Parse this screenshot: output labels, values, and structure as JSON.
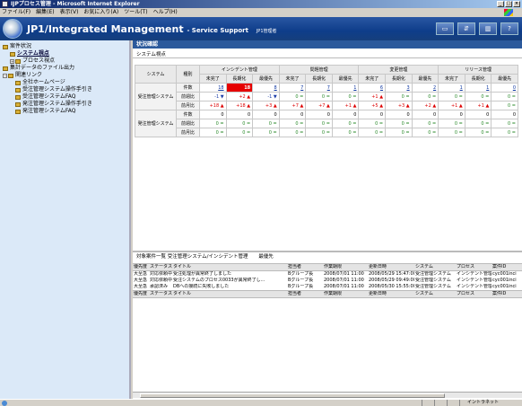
{
  "window": {
    "title": "IJPプロセス管理 - Microsoft Internet Explorer"
  },
  "menu": [
    "ファイル(F)",
    "編集(E)",
    "表示(V)",
    "お気に入り(A)",
    "ツール(T)",
    "ヘルプ(H)"
  ],
  "header": {
    "title": "JP1/Integrated Management",
    "subtitle": "- Service Support",
    "manager": "JP1管理者"
  },
  "sidebar": {
    "items": [
      {
        "label": "案件状況",
        "level": 1
      },
      {
        "label": "システム視点",
        "level": 2,
        "selected": true
      },
      {
        "label": "プロセス視点",
        "level": 2
      },
      {
        "label": "集計データのファイル出力",
        "level": 1
      },
      {
        "label": "関連リンク",
        "level": 1
      },
      {
        "label": "全社ホームページ",
        "level": 3
      },
      {
        "label": "受注管理システム操作手引き",
        "level": 3
      },
      {
        "label": "受注管理システムFAQ",
        "level": 3
      },
      {
        "label": "発注管理システム操作手引き",
        "level": 3
      },
      {
        "label": "発注管理システムFAQ",
        "level": 3
      }
    ]
  },
  "main": {
    "header": "状況確認",
    "section": "システム視点",
    "table": {
      "col_system": "システム",
      "col_kind": "種別",
      "groups": [
        "インシデント管理",
        "問題管理",
        "変更管理",
        "リリース管理"
      ],
      "subcols": [
        "未完了",
        "長期化",
        "最優先"
      ],
      "systems": [
        {
          "name": "受注管理システム",
          "rows": [
            {
              "label": "件数",
              "cells": [
                "18",
                "18",
                "8",
                "7",
                "7",
                "1",
                "6",
                "3",
                "2",
                "1",
                "1",
                "0"
              ]
            },
            {
              "label": "前週比",
              "cells": [
                "-1 ▼",
                "+2 ▲",
                "-1 ▼",
                "0 =",
                "0 =",
                "0 =",
                "+1 ▲",
                "0 =",
                "0 =",
                "0 =",
                "0 =",
                "0 ="
              ]
            },
            {
              "label": "前月比",
              "cells": [
                "+18 ▲",
                "+18 ▲",
                "+3 ▲",
                "+7 ▲",
                "+7 ▲",
                "+1 ▲",
                "+5 ▲",
                "+3 ▲",
                "+2 ▲",
                "+1 ▲",
                "+1 ▲",
                "0 ="
              ]
            }
          ]
        },
        {
          "name": "発注管理システム",
          "rows": [
            {
              "label": "件数",
              "cells": [
                "0",
                "0",
                "0",
                "0",
                "0",
                "0",
                "0",
                "0",
                "0",
                "0",
                "0",
                "0"
              ]
            },
            {
              "label": "前週比",
              "cells": [
                "0 =",
                "0 =",
                "0 =",
                "0 =",
                "0 =",
                "0 =",
                "0 =",
                "0 =",
                "0 =",
                "0 =",
                "0 =",
                "0 ="
              ]
            },
            {
              "label": "前月比",
              "cells": [
                "0 =",
                "0 =",
                "0 =",
                "0 =",
                "0 =",
                "0 =",
                "0 =",
                "0 =",
                "0 =",
                "0 =",
                "0 =",
                "0 ="
              ]
            }
          ]
        }
      ]
    },
    "list": {
      "title": "対象案件一覧 受注管理システム/インシデント管理",
      "tab": "最優先",
      "columns": [
        "優先度",
        "ステータス",
        "タイトル",
        "担当者",
        "作業期限",
        "更新日時",
        "システム",
        "プロセス",
        "案件ID"
      ],
      "rows": [
        [
          "大至急",
          "対応依頼中",
          "受注処理が異常終了しました",
          "Bグループ長",
          "2008/07/01 11:00",
          "2008/05/29 15:47:00",
          "受注管理システム",
          "インシデント管理",
          "cyc001inci"
        ],
        [
          "大至急",
          "対応依頼中",
          "受注システムのプロセス0033が異常終了し...",
          "Bグループ長",
          "2008/07/01 11:00",
          "2008/05/29 09:49:00",
          "受注管理システム",
          "インシデント管理",
          "cyc001inci"
        ],
        [
          "大至急",
          "承認済み",
          "DBへの接続に失敗しました",
          "Bグループ長",
          "2008/07/01 11:00",
          "2008/05/30 15:55:00",
          "受注管理システム",
          "インシデント管理",
          "cyc001inci"
        ]
      ]
    }
  },
  "status": {
    "zone": "イントラネット"
  }
}
